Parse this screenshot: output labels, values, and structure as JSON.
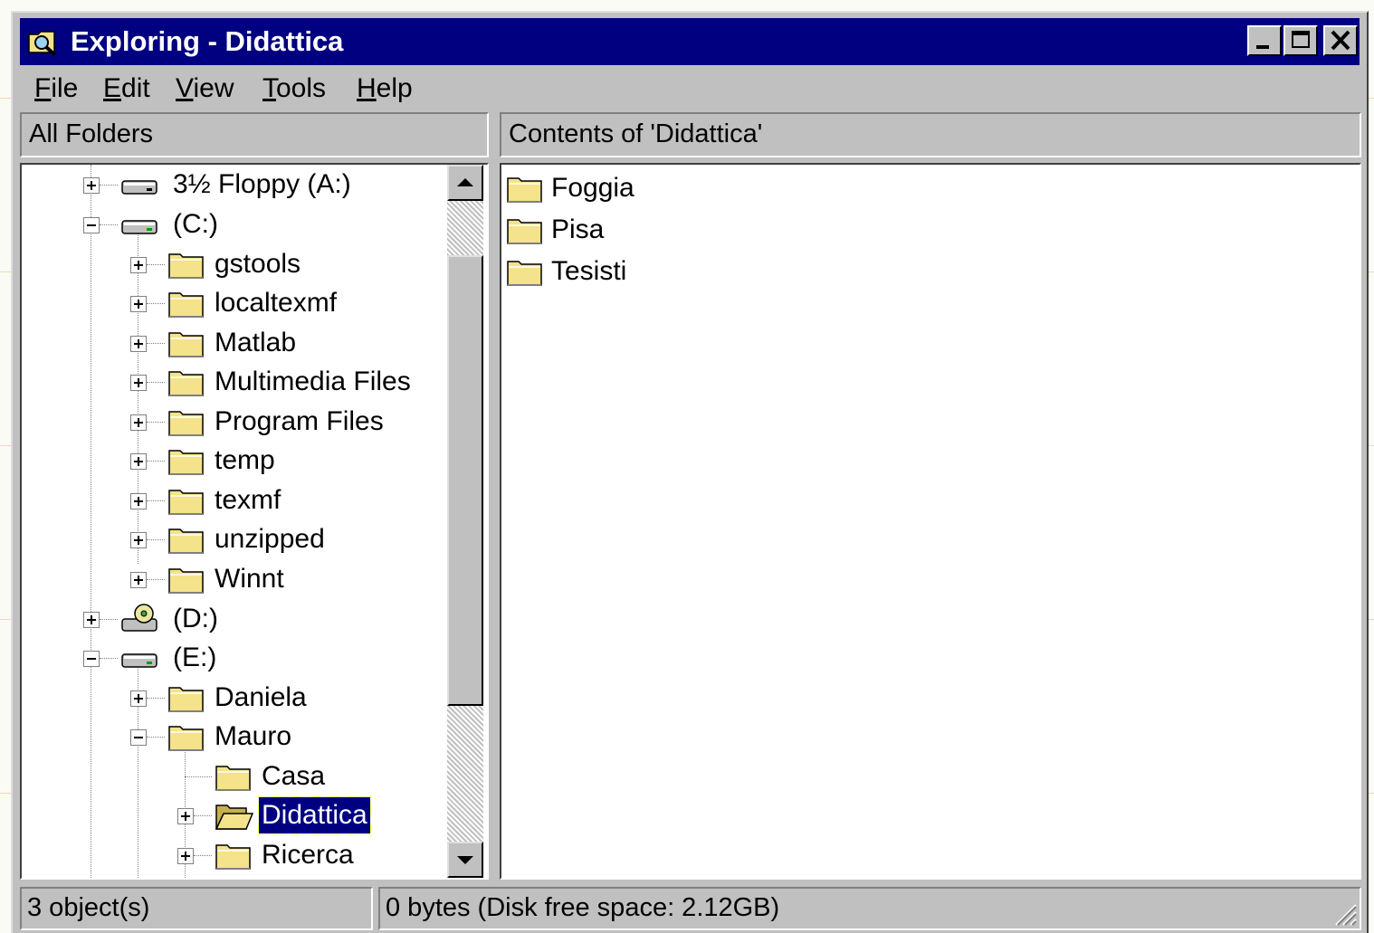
{
  "window": {
    "title": "Exploring - Didattica"
  },
  "menu": [
    "File",
    "Edit",
    "View",
    "Tools",
    "Help"
  ],
  "left_header": "All Folders",
  "right_header": "Contents of 'Didattica'",
  "tree": [
    {
      "label": "3½ Floppy (A:)",
      "icon": "floppy-drive-icon",
      "expander": "plus"
    },
    {
      "label": "(C:)",
      "icon": "hard-drive-icon",
      "expander": "minus"
    },
    {
      "label": "gstools",
      "icon": "folder-icon",
      "expander": "plus"
    },
    {
      "label": "localtexmf",
      "icon": "folder-icon",
      "expander": "plus"
    },
    {
      "label": "Matlab",
      "icon": "folder-icon",
      "expander": "plus"
    },
    {
      "label": "Multimedia Files",
      "icon": "folder-icon",
      "expander": "plus"
    },
    {
      "label": "Program Files",
      "icon": "folder-icon",
      "expander": "plus"
    },
    {
      "label": "temp",
      "icon": "folder-icon",
      "expander": "plus"
    },
    {
      "label": "texmf",
      "icon": "folder-icon",
      "expander": "plus"
    },
    {
      "label": "unzipped",
      "icon": "folder-icon",
      "expander": "plus"
    },
    {
      "label": "Winnt",
      "icon": "folder-icon",
      "expander": "plus"
    },
    {
      "label": "(D:)",
      "icon": "cd-drive-icon",
      "expander": "plus"
    },
    {
      "label": "(E:)",
      "icon": "hard-drive-icon",
      "expander": "minus"
    },
    {
      "label": "Daniela",
      "icon": "folder-icon",
      "expander": "plus"
    },
    {
      "label": "Mauro",
      "icon": "folder-icon",
      "expander": "minus"
    },
    {
      "label": "Casa",
      "icon": "folder-icon",
      "expander": "none"
    },
    {
      "label": "Didattica",
      "icon": "open-folder-icon",
      "expander": "plus",
      "selected": true
    },
    {
      "label": "Ricerca",
      "icon": "folder-icon",
      "expander": "plus"
    }
  ],
  "contents": [
    {
      "label": "Foggia",
      "icon": "folder-icon"
    },
    {
      "label": "Pisa",
      "icon": "folder-icon"
    },
    {
      "label": "Tesisti",
      "icon": "folder-icon"
    }
  ],
  "status": {
    "objects": "3 object(s)",
    "space": "0 bytes (Disk free space: 2.12GB)"
  },
  "colors": {
    "titlebar": "#000080",
    "face": "#c0c0c0",
    "folder": "#f4e38a",
    "selection": "#000080"
  }
}
